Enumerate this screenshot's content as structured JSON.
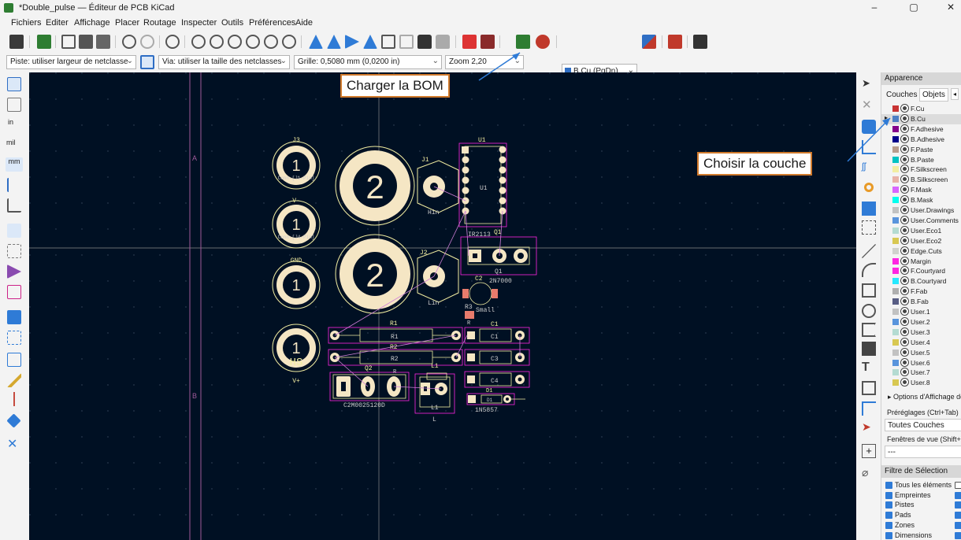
{
  "window": {
    "title": "*Double_pulse — Éditeur de PCB KiCad",
    "minimize": "–",
    "maximize": "▢",
    "close": "✕"
  },
  "menu": [
    "Fichiers",
    "Editer",
    "Affichage",
    "Placer",
    "Routage",
    "Inspecter",
    "Outils",
    "Préférences",
    "Aide"
  ],
  "toolbar": {
    "layer_select": "B.Cu (PgDn)"
  },
  "options": {
    "track": "Piste: utiliser largeur de netclasse",
    "via": "Via: utiliser la taille des netclasses",
    "grid": "Grille: 0,5080 mm (0,0200 in)",
    "zoom": "Zoom 2,20"
  },
  "left_tools": {
    "in": "in",
    "mil": "mil",
    "mm": "mm"
  },
  "canvas": {
    "sheet_labels": [
      "A",
      "B"
    ],
    "refs": {
      "J3": "J3",
      "J3_val": "Conn-[J1-Pin]",
      "V_label": "V-",
      "J4_val": "Conn-[J4-Pin]",
      "gnd": "GND",
      "vplus": "V+",
      "hs": "HS",
      "nos": "1",
      "J1": "J1",
      "hin": "Hin",
      "J2": "J2",
      "lin": "Lin",
      "u1": "U1",
      "u1b": "U1",
      "ir": "IR2113",
      "q1": "Q1",
      "q1b": "Q1",
      "npn": "2N7000",
      "c2": "C2",
      "r3": "R3",
      "small": "Small",
      "r_lbl": "R",
      "r1": "R1",
      "r1b": "R1",
      "r2": "R2",
      "r2b": "R2",
      "c1": "C1",
      "c1b": "C1",
      "c3": "C3",
      "c4": "C4",
      "q2": "Q2",
      "q2p": "R",
      "c2m": "C2M0025120D",
      "l1": "L1",
      "l1b": "L1",
      "l": "L",
      "d1": "D1",
      "d1b": "D1",
      "diode": "1N5857",
      "csmall": "C_Small",
      "big2": "2"
    }
  },
  "callouts": {
    "bom": "Charger la BOM",
    "layer": "Choisir la couche"
  },
  "panel": {
    "title": "Apparence",
    "tabs": [
      "Couches",
      "Objets"
    ],
    "layers": [
      {
        "name": "F.Cu",
        "color": "#c83434"
      },
      {
        "name": "B.Cu",
        "color": "#4d7fc4"
      },
      {
        "name": "F.Adhesive",
        "color": "#84008a"
      },
      {
        "name": "B.Adhesive",
        "color": "#00008a"
      },
      {
        "name": "F.Paste",
        "color": "#b89c8c"
      },
      {
        "name": "B.Paste",
        "color": "#00c2c2"
      },
      {
        "name": "F.Silkscreen",
        "color": "#f2eda1"
      },
      {
        "name": "B.Silkscreen",
        "color": "#e8b2a7"
      },
      {
        "name": "F.Mask",
        "color": "#d864ff"
      },
      {
        "name": "B.Mask",
        "color": "#02ffee"
      },
      {
        "name": "User.Drawings",
        "color": "#c2c2c2"
      },
      {
        "name": "User.Comments",
        "color": "#5994dc"
      },
      {
        "name": "User.Eco1",
        "color": "#b4dbd2"
      },
      {
        "name": "User.Eco2",
        "color": "#d8c852"
      },
      {
        "name": "Edge.Cuts",
        "color": "#d0d2cd"
      },
      {
        "name": "Margin",
        "color": "#ff26e2"
      },
      {
        "name": "F.Courtyard",
        "color": "#ff26e2"
      },
      {
        "name": "B.Courtyard",
        "color": "#26e9ff"
      },
      {
        "name": "F.Fab",
        "color": "#afafaf"
      },
      {
        "name": "B.Fab",
        "color": "#585d84"
      },
      {
        "name": "User.1",
        "color": "#c2c2c2"
      },
      {
        "name": "User.2",
        "color": "#5994dc"
      },
      {
        "name": "User.3",
        "color": "#b4dbd2"
      },
      {
        "name": "User.4",
        "color": "#d8c852"
      },
      {
        "name": "User.5",
        "color": "#c2c2c2"
      },
      {
        "name": "User.6",
        "color": "#5994dc"
      },
      {
        "name": "User.7",
        "color": "#b4dbd2"
      },
      {
        "name": "User.8",
        "color": "#d8c852"
      }
    ],
    "display_options": "Options d'Affichage de",
    "presets_label": "Préréglages (Ctrl+Tab) :",
    "presets_value": "Toutes Couches",
    "viewports_label": "Fenêtres de vue (Shift+Tab)",
    "viewports_value": "---",
    "filter_title": "Filtre de Sélection",
    "filters": [
      "Tous les éléments",
      "Empreintes",
      "Pistes",
      "Pads",
      "Zones",
      "Dimensions"
    ]
  }
}
